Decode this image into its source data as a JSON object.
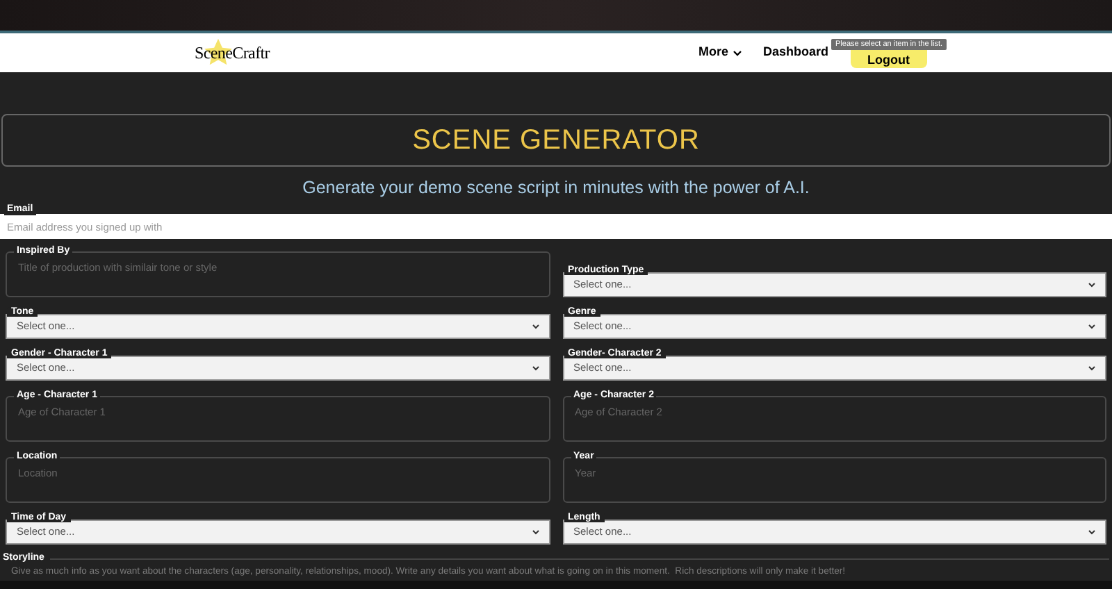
{
  "nav": {
    "logo": "SceneCraftr",
    "links": [
      {
        "label": "More",
        "dropdown": true
      },
      {
        "label": "Dashboard",
        "dropdown": false
      }
    ],
    "button": "Logout",
    "tooltip": "Please select an item in the list."
  },
  "header": {
    "title": "SCENE GENERATOR",
    "subtitle": "Generate your demo scene script in minutes with the power of A.I."
  },
  "email": {
    "label": "Email",
    "placeholder": "Email address you signed up with"
  },
  "rows": [
    [
      {
        "kind": "textarea",
        "label": "Inspired By",
        "placeholder": "Title of production with similair tone or style"
      },
      {
        "kind": "select",
        "label": "Production Type",
        "value": "Select one..."
      }
    ],
    [
      {
        "kind": "select",
        "label": "Tone",
        "value": "Select one..."
      },
      {
        "kind": "select",
        "label": "Genre",
        "value": "Select one..."
      }
    ],
    [
      {
        "kind": "select",
        "label": "Gender - Character 1",
        "value": "Select one..."
      },
      {
        "kind": "select",
        "label": "Gender- Character 2",
        "value": "Select one..."
      }
    ],
    [
      {
        "kind": "textarea",
        "label": "Age - Character 1",
        "placeholder": "Age of Character 1"
      },
      {
        "kind": "textarea",
        "label": "Age - Character 2",
        "placeholder": "Age of Character 2"
      }
    ],
    [
      {
        "kind": "textarea",
        "label": "Location",
        "placeholder": "Location"
      },
      {
        "kind": "textarea",
        "label": "Year",
        "placeholder": "Year"
      }
    ],
    [
      {
        "kind": "select",
        "label": "Time of Day",
        "value": "Select one..."
      },
      {
        "kind": "select",
        "label": "Length",
        "value": "Select one..."
      }
    ]
  ],
  "storyline": {
    "label": "Storyline",
    "placeholder": "Give as much info as you want about the characters (age, personality, relationships, mood). Write any details you want about what is going on in this moment.  Rich descriptions will only make it better!"
  }
}
